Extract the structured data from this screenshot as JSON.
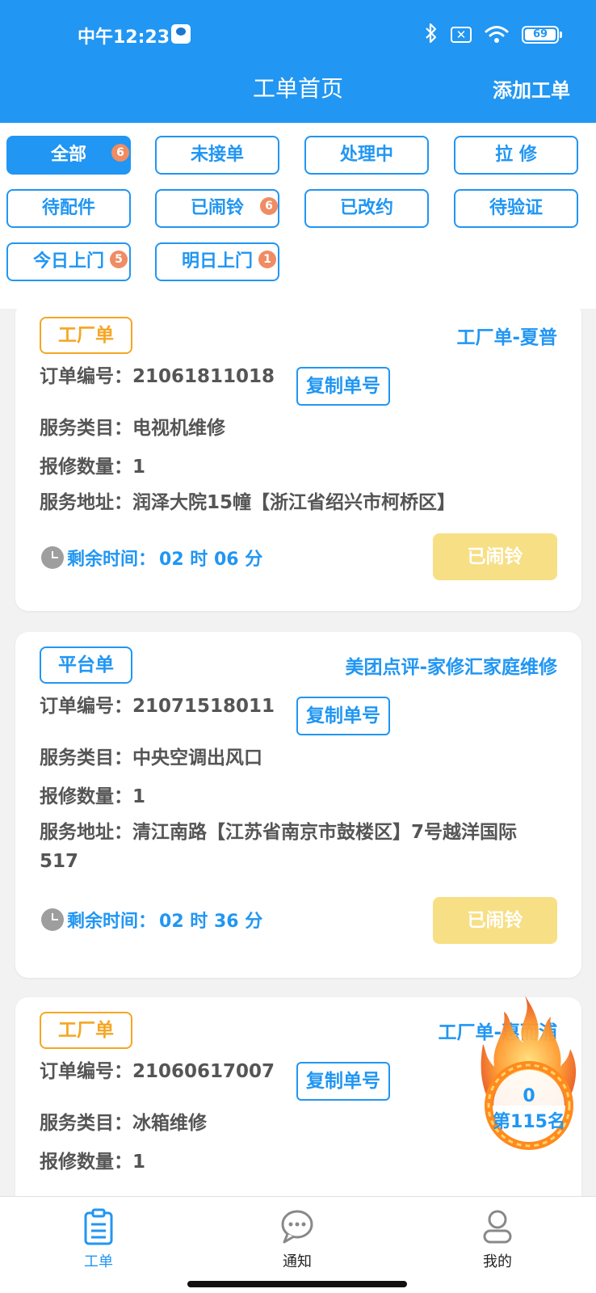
{
  "status_bar": {
    "time": "中午12:23",
    "battery": "69",
    "x_label": "✕"
  },
  "header": {
    "title": "工单首页",
    "add_button": "添加工单"
  },
  "filters": {
    "all": "全部",
    "all_badge": "6",
    "unaccepted": "未接单",
    "processing": "处理中",
    "pull_repair": "拉 修",
    "waiting_parts": "待配件",
    "alarmed": "已闹铃",
    "alarmed_badge": "6",
    "rescheduled": "已改约",
    "to_verify": "待验证",
    "today_visit": "今日上门",
    "today_badge": "5",
    "tomorrow_visit": "明日上门",
    "tomorrow_badge": "1"
  },
  "labels": {
    "order_no": "订单编号：",
    "service_type": "服务类目：",
    "quantity": "报修数量：",
    "address": "服务地址：",
    "copy": "复制单号",
    "remaining": "剩余时间：",
    "alarm_button": "已闹铃"
  },
  "orders": [
    {
      "tag": "工厂单",
      "source": "工厂单-夏普",
      "order_no": "21061811018",
      "service_type": "电视机维修",
      "quantity": "1",
      "address": "润泽大院15幢【浙江省绍兴市柯桥区】",
      "remaining": "02 时 06 分"
    },
    {
      "tag": "平台单",
      "source": "美团点评-家修汇家庭维修",
      "order_no": "21071518011",
      "service_type": "中央空调出风口",
      "quantity": "1",
      "address": "清江南路【江苏省南京市鼓楼区】7号越洋国际517",
      "remaining": "02 时 36 分"
    },
    {
      "tag": "工厂单",
      "source": "工厂单-惠而浦",
      "order_no": "21060617007",
      "service_type": "冰箱维修",
      "quantity": "1"
    }
  ],
  "ranking": {
    "number": "0",
    "label": "第115名"
  },
  "bottom_nav": {
    "orders": "工单",
    "notify": "通知",
    "mine": "我的"
  },
  "colors": {
    "primary": "#2196F3",
    "factory_tag": "#F5A623",
    "alarm_button": "#F7DF85",
    "badge": "#F08C63"
  }
}
